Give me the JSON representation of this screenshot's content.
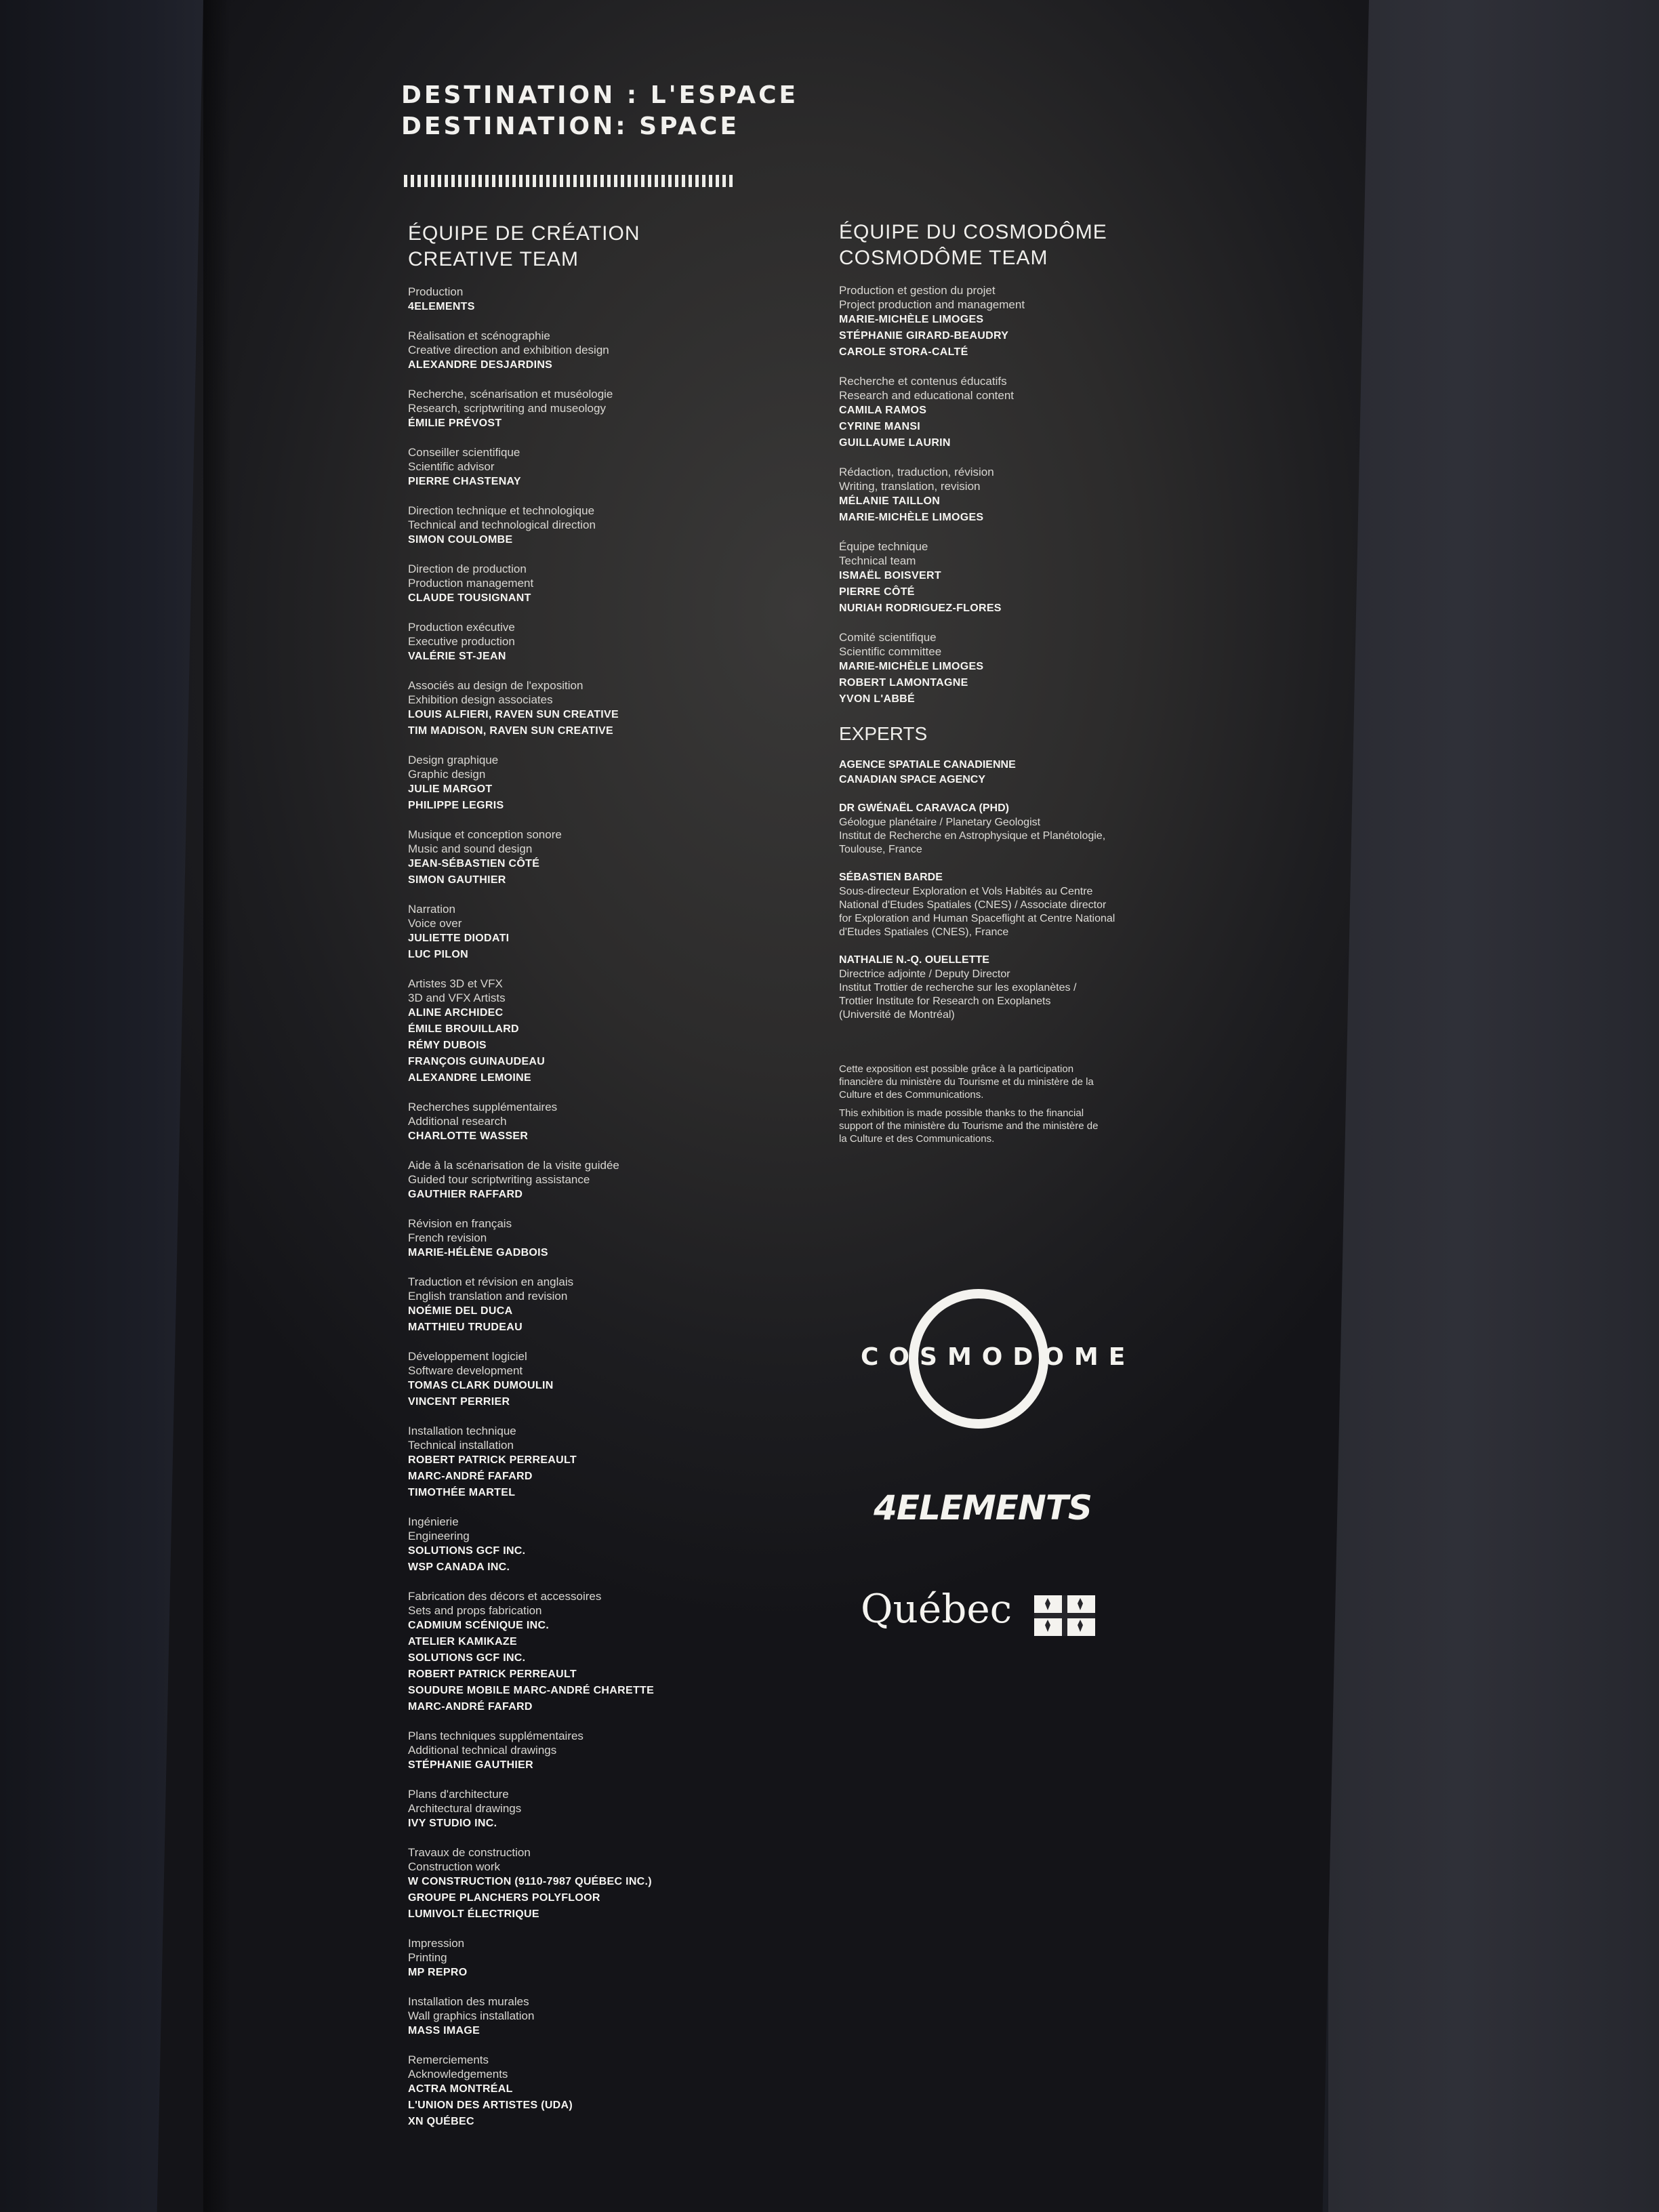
{
  "title": {
    "line1": "DESTINATION : L'ESPACE",
    "line2": "DESTINATION: SPACE"
  },
  "creative": {
    "heading1": "ÉQUIPE DE CRÉATION",
    "heading2": "CREATIVE TEAM",
    "groups": [
      {
        "roles": [
          "Production"
        ],
        "names": [
          "4ELEMENTS"
        ]
      },
      {
        "roles": [
          "Réalisation et scénographie",
          "Creative direction and exhibition design"
        ],
        "names": [
          "ALEXANDRE DESJARDINS"
        ]
      },
      {
        "roles": [
          "Recherche, scénarisation et muséologie",
          "Research, scriptwriting and museology"
        ],
        "names": [
          "ÉMILIE PRÉVOST"
        ]
      },
      {
        "roles": [
          "Conseiller scientifique",
          "Scientific advisor"
        ],
        "names": [
          "PIERRE CHASTENAY"
        ]
      },
      {
        "roles": [
          "Direction technique et technologique",
          "Technical and technological direction"
        ],
        "names": [
          "SIMON COULOMBE"
        ]
      },
      {
        "roles": [
          "Direction de production",
          "Production management"
        ],
        "names": [
          "CLAUDE TOUSIGNANT"
        ]
      },
      {
        "roles": [
          "Production exécutive",
          "Executive production"
        ],
        "names": [
          "VALÉRIE ST-JEAN"
        ]
      },
      {
        "roles": [
          "Associés au design de l'exposition",
          "Exhibition design associates"
        ],
        "names": [
          "LOUIS ALFIERI, RAVEN SUN CREATIVE",
          "TIM MADISON, RAVEN SUN CREATIVE"
        ]
      },
      {
        "roles": [
          "Design graphique",
          "Graphic design"
        ],
        "names": [
          "JULIE MARGOT",
          "PHILIPPE LEGRIS"
        ]
      },
      {
        "roles": [
          "Musique et conception sonore",
          "Music and sound design"
        ],
        "names": [
          "JEAN-SÉBASTIEN CÔTÉ",
          "SIMON GAUTHIER"
        ]
      },
      {
        "roles": [
          "Narration",
          "Voice over"
        ],
        "names": [
          "JULIETTE DIODATI",
          "LUC PILON"
        ]
      },
      {
        "roles": [
          "Artistes 3D et VFX",
          "3D and VFX Artists"
        ],
        "names": [
          "ALINE ARCHIDEC",
          "ÉMILE BROUILLARD",
          "RÉMY DUBOIS",
          "FRANÇOIS GUINAUDEAU",
          "ALEXANDRE LEMOINE"
        ]
      },
      {
        "roles": [
          "Recherches supplémentaires",
          "Additional research"
        ],
        "names": [
          "CHARLOTTE WASSER"
        ]
      },
      {
        "roles": [
          "Aide à la scénarisation de la visite guidée",
          "Guided tour scriptwriting assistance"
        ],
        "names": [
          "GAUTHIER RAFFARD"
        ]
      },
      {
        "roles": [
          "Révision en français",
          "French revision"
        ],
        "names": [
          "MARIE-HÉLÈNE GADBOIS"
        ]
      },
      {
        "roles": [
          "Traduction et révision en anglais",
          "English translation and revision"
        ],
        "names": [
          "NOÉMIE DEL DUCA",
          "MATTHIEU TRUDEAU"
        ]
      },
      {
        "roles": [
          "Développement logiciel",
          "Software development"
        ],
        "names": [
          "TOMAS CLARK DUMOULIN",
          "VINCENT PERRIER"
        ]
      },
      {
        "roles": [
          "Installation technique",
          "Technical installation"
        ],
        "names": [
          "ROBERT PATRICK PERREAULT",
          "MARC-ANDRÉ FAFARD",
          "TIMOTHÉE MARTEL"
        ]
      },
      {
        "roles": [
          "Ingénierie",
          "Engineering"
        ],
        "names": [
          "SOLUTIONS GCF INC.",
          "WSP CANADA INC."
        ]
      },
      {
        "roles": [
          "Fabrication des décors et accessoires",
          "Sets and props fabrication"
        ],
        "names": [
          "CADMIUM SCÉNIQUE INC.",
          "ATELIER KAMIKAZE",
          "SOLUTIONS GCF INC.",
          "ROBERT PATRICK PERREAULT",
          "SOUDURE MOBILE MARC-ANDRÉ CHARETTE",
          "MARC-ANDRÉ FAFARD"
        ]
      },
      {
        "roles": [
          "Plans techniques supplémentaires",
          "Additional technical drawings"
        ],
        "names": [
          "STÉPHANIE GAUTHIER"
        ]
      },
      {
        "roles": [
          "Plans d'architecture",
          "Architectural drawings"
        ],
        "names": [
          "IVY STUDIO INC."
        ]
      },
      {
        "roles": [
          "Travaux de construction",
          "Construction work"
        ],
        "names": [
          "W CONSTRUCTION (9110-7987 QUÉBEC INC.)",
          "GROUPE PLANCHERS POLYFLOOR",
          "LUMIVOLT ÉLECTRIQUE"
        ]
      },
      {
        "roles": [
          "Impression",
          "Printing"
        ],
        "names": [
          "MP REPRO"
        ]
      },
      {
        "roles": [
          "Installation des murales",
          "Wall graphics installation"
        ],
        "names": [
          "MASS IMAGE"
        ]
      },
      {
        "roles": [
          "Remerciements",
          "Acknowledgements"
        ],
        "names": [
          "ACTRA MONTRÉAL",
          "L'UNION DES ARTISTES (UDA)",
          "XN QUÉBEC"
        ]
      }
    ]
  },
  "cosmodome": {
    "heading1": "ÉQUIPE DU COSMODÔME",
    "heading2": "COSMODÔME TEAM",
    "groups": [
      {
        "roles": [
          "Production et gestion du projet",
          "Project production and management"
        ],
        "names": [
          "MARIE-MICHÈLE LIMOGES",
          "STÉPHANIE GIRARD-BEAUDRY",
          "CAROLE STORA-CALTÉ"
        ]
      },
      {
        "roles": [
          "Recherche et contenus éducatifs",
          "Research and educational content"
        ],
        "names": [
          "CAMILA RAMOS",
          "CYRINE MANSI",
          "GUILLAUME LAURIN"
        ]
      },
      {
        "roles": [
          "Rédaction, traduction, révision",
          "Writing, translation, revision"
        ],
        "names": [
          "MÉLANIE TAILLON",
          "MARIE-MICHÈLE LIMOGES"
        ]
      },
      {
        "roles": [
          "Équipe technique",
          "Technical team"
        ],
        "names": [
          "ISMAËL BOISVERT",
          "PIERRE CÔTÉ",
          "NURIAH RODRIGUEZ-FLORES"
        ]
      },
      {
        "roles": [
          "Comité scientifique",
          "Scientific committee"
        ],
        "names": [
          "MARIE-MICHÈLE LIMOGES",
          "ROBERT LAMONTAGNE",
          "YVON L'ABBÉ"
        ]
      }
    ]
  },
  "experts": {
    "heading": "EXPERTS",
    "entries": [
      {
        "names": [
          "AGENCE SPATIALE CANADIENNE",
          "CANADIAN SPACE AGENCY"
        ],
        "desc": []
      },
      {
        "names": [
          "DR GWÉNAËL CARAVACA (PHD)"
        ],
        "desc": [
          "Géologue planétaire / Planetary Geologist",
          "Institut de Recherche en Astrophysique et Planétologie,",
          "Toulouse, France"
        ]
      },
      {
        "names": [
          "SÉBASTIEN BARDE"
        ],
        "desc": [
          "Sous-directeur Exploration et Vols Habités au Centre",
          "National d'Etudes Spatiales (CNES) / Associate director",
          "for Exploration and Human Spaceflight at Centre National",
          "d'Etudes Spatiales (CNES), France"
        ]
      },
      {
        "names": [
          "NATHALIE N.-Q. OUELLETTE"
        ],
        "desc": [
          "Directrice adjointe / Deputy Director",
          "Institut Trottier de recherche sur les exoplanètes /",
          "Trottier Institute for Research on Exoplanets",
          "(Université de Montréal)"
        ]
      }
    ]
  },
  "funding": {
    "fr": [
      "Cette exposition est possible grâce à la participation",
      "financière du ministère du Tourisme et du ministère de la",
      "Culture et des Communications."
    ],
    "en": [
      "This exhibition is made possible thanks to the financial",
      "support of the ministère du Tourisme and the ministère de",
      "la Culture et des Communications."
    ]
  },
  "logos": {
    "cosmodome": "COSMODOME",
    "fourelements": "4ELEMENTS",
    "quebec": "Québec",
    "quebec_icon": "fleur-de-lis-flag-icon"
  }
}
